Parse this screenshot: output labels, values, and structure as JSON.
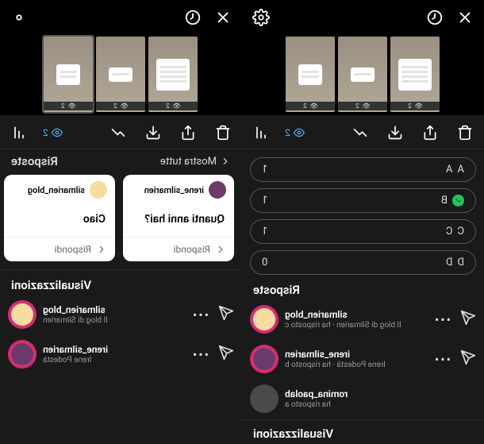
{
  "topbar_left": {
    "eye_count": "2",
    "poll_options": [
      {
        "letter": "A",
        "label": "A",
        "votes": "1",
        "checked": false
      },
      {
        "letter": "B",
        "label": "B",
        "votes": "1",
        "checked": true
      },
      {
        "letter": "C",
        "label": "C",
        "votes": "1",
        "checked": false
      },
      {
        "letter": "D",
        "label": "D",
        "votes": "0",
        "checked": false
      }
    ],
    "section_risposte": "Risposte",
    "responses": [
      {
        "name": "silmarien_blog",
        "sub": "Il blog di Silmarien · ha risposto c",
        "avatar_color": "#f5dca0",
        "ring": true,
        "share": true
      },
      {
        "name": "irene_silmarien",
        "sub": "Irene Podestà · ha risposto b",
        "avatar_color": "#6b3a6b",
        "ring": true,
        "share": true
      },
      {
        "name": "romina_paolab",
        "sub": "ha risposto a",
        "avatar_color": "#4a4a4a",
        "ring": false,
        "share": false
      }
    ],
    "section_visual": "Visualizzazioni"
  },
  "right": {
    "eye_count": "2",
    "show_all": "Mostra tutte",
    "section_risposte": "Risposte",
    "questions": [
      {
        "user": "irene_silmarien",
        "text": "Quanti anni hai?",
        "reply": "Rispondi",
        "avatar_color": "#6b3a6b"
      },
      {
        "user": "silmarien_blog",
        "text": "Ciao",
        "reply": "Rispondi",
        "avatar_color": "#f5dca0"
      }
    ],
    "section_visual": "Visualizzazioni",
    "viewers": [
      {
        "name": "silmarien_blog",
        "sub": "Il blog di Silmarien",
        "avatar_color": "#f5dca0"
      },
      {
        "name": "irene_silmarien",
        "sub": "Irene Podestà",
        "avatar_color": "#6b3a6b"
      }
    ]
  },
  "thumb_count": "2"
}
